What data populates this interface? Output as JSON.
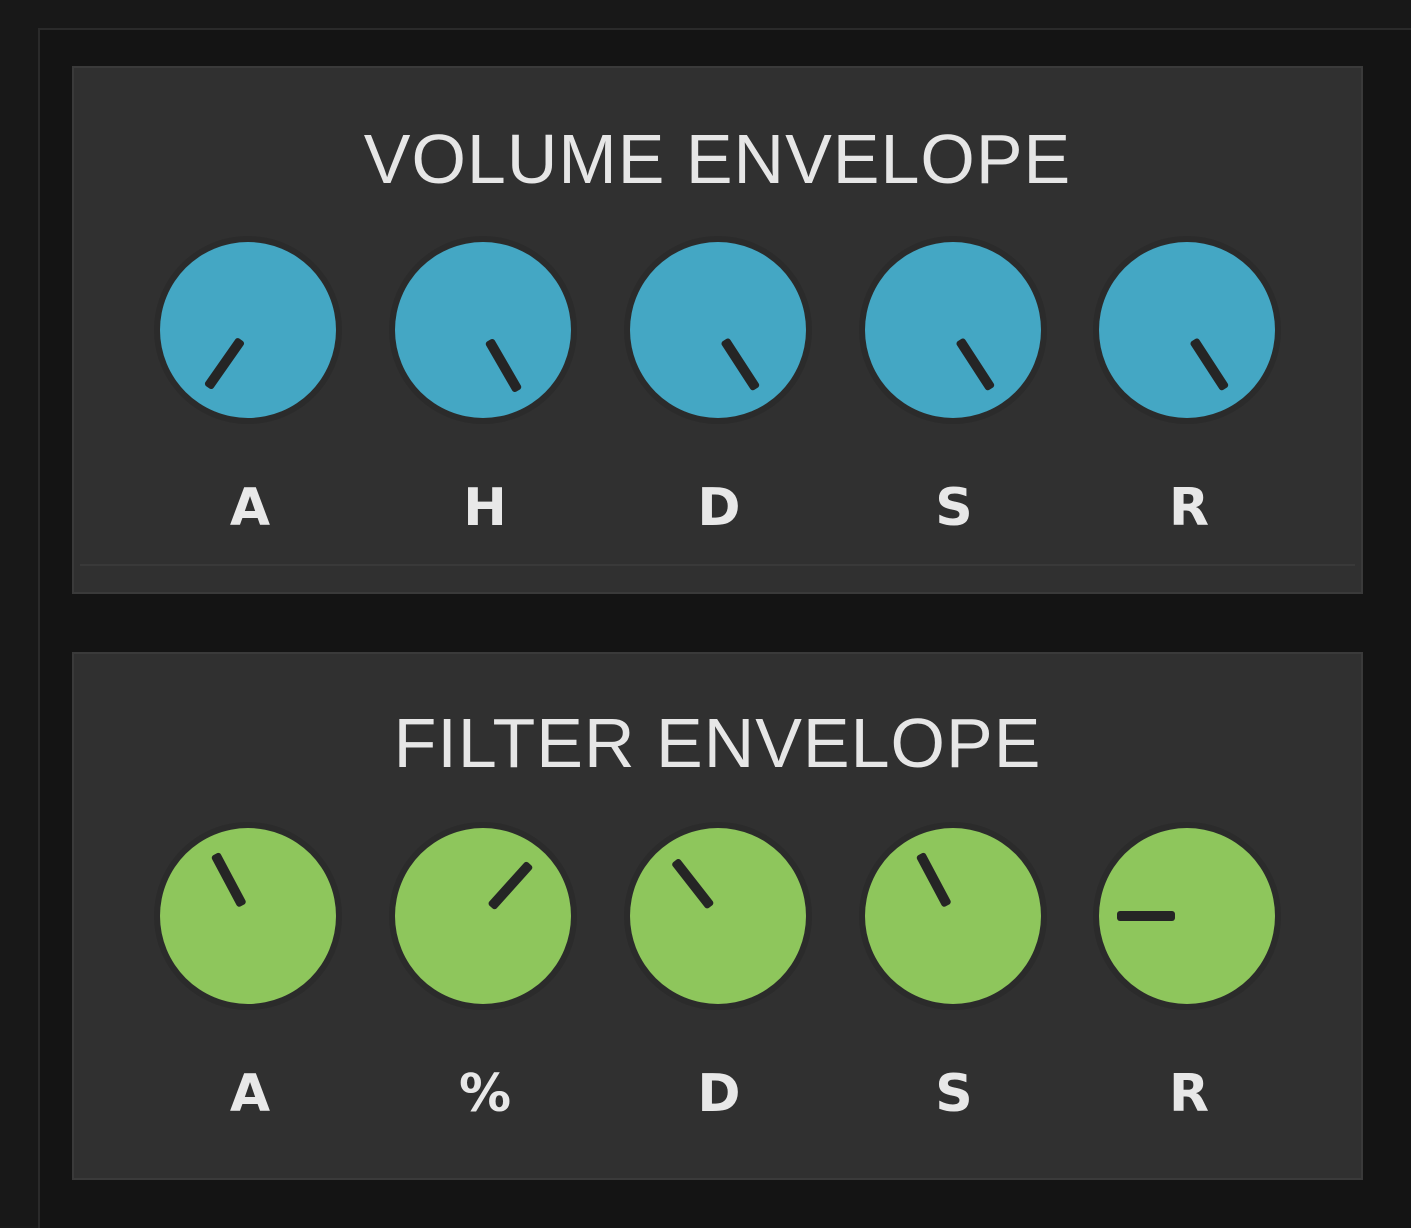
{
  "colors": {
    "volume_knob": "#44a7c4",
    "filter_knob": "#8ec65c",
    "panel_bg": "#303030",
    "title_text": "#e6e6e6"
  },
  "volume_envelope": {
    "title": "VOLUME ENVELOPE",
    "knobs": [
      {
        "label": "A",
        "pointer_angle_deg": 35
      },
      {
        "label": "H",
        "pointer_angle_deg": -30
      },
      {
        "label": "D",
        "pointer_angle_deg": -33
      },
      {
        "label": "S",
        "pointer_angle_deg": -33
      },
      {
        "label": "R",
        "pointer_angle_deg": -33
      }
    ]
  },
  "filter_envelope": {
    "title": "FILTER ENVELOPE",
    "knobs": [
      {
        "label": "A",
        "pointer_angle_deg": 152
      },
      {
        "label": "%",
        "pointer_angle_deg": -138
      },
      {
        "label": "D",
        "pointer_angle_deg": 142
      },
      {
        "label": "S",
        "pointer_angle_deg": 152
      },
      {
        "label": "R",
        "pointer_angle_deg": 90
      }
    ]
  }
}
